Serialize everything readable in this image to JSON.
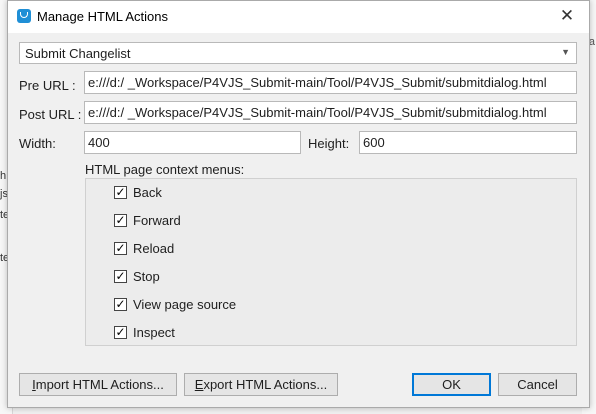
{
  "background": {
    "left_fragments": [
      "h",
      "js",
      "te",
      "te"
    ],
    "right_fragments": [
      "ea"
    ]
  },
  "dialog": {
    "title": "Manage HTML Actions",
    "close_glyph": "✕",
    "preset": {
      "selected": "Submit Changelist"
    },
    "pre_url": {
      "label": "Pre URL :",
      "value": "e:///d:/          _Workspace/P4VJS_Submit-main/Tool/P4VJS_Submit/submitdialog.html"
    },
    "post_url": {
      "label": "Post URL :",
      "value": "e:///d:/          _Workspace/P4VJS_Submit-main/Tool/P4VJS_Submit/submitdialog.html"
    },
    "width": {
      "label": "Width:",
      "value": "400"
    },
    "height": {
      "label": "Height:",
      "value": "600"
    },
    "context_menus": {
      "title": "HTML page context menus:",
      "items": [
        {
          "label": "Back",
          "checked": true
        },
        {
          "label": "Forward",
          "checked": true
        },
        {
          "label": "Reload",
          "checked": true
        },
        {
          "label": "Stop",
          "checked": true
        },
        {
          "label": "View page source",
          "checked": true
        },
        {
          "label": "Inspect",
          "checked": true
        }
      ]
    },
    "buttons": {
      "import_prefix": "I",
      "import_rest": "mport HTML Actions...",
      "export_prefix": "E",
      "export_rest": "xport HTML Actions...",
      "ok": "OK",
      "cancel": "Cancel"
    }
  },
  "colors": {
    "accent": "#0078d7",
    "app_icon": "#1f8fd6"
  }
}
